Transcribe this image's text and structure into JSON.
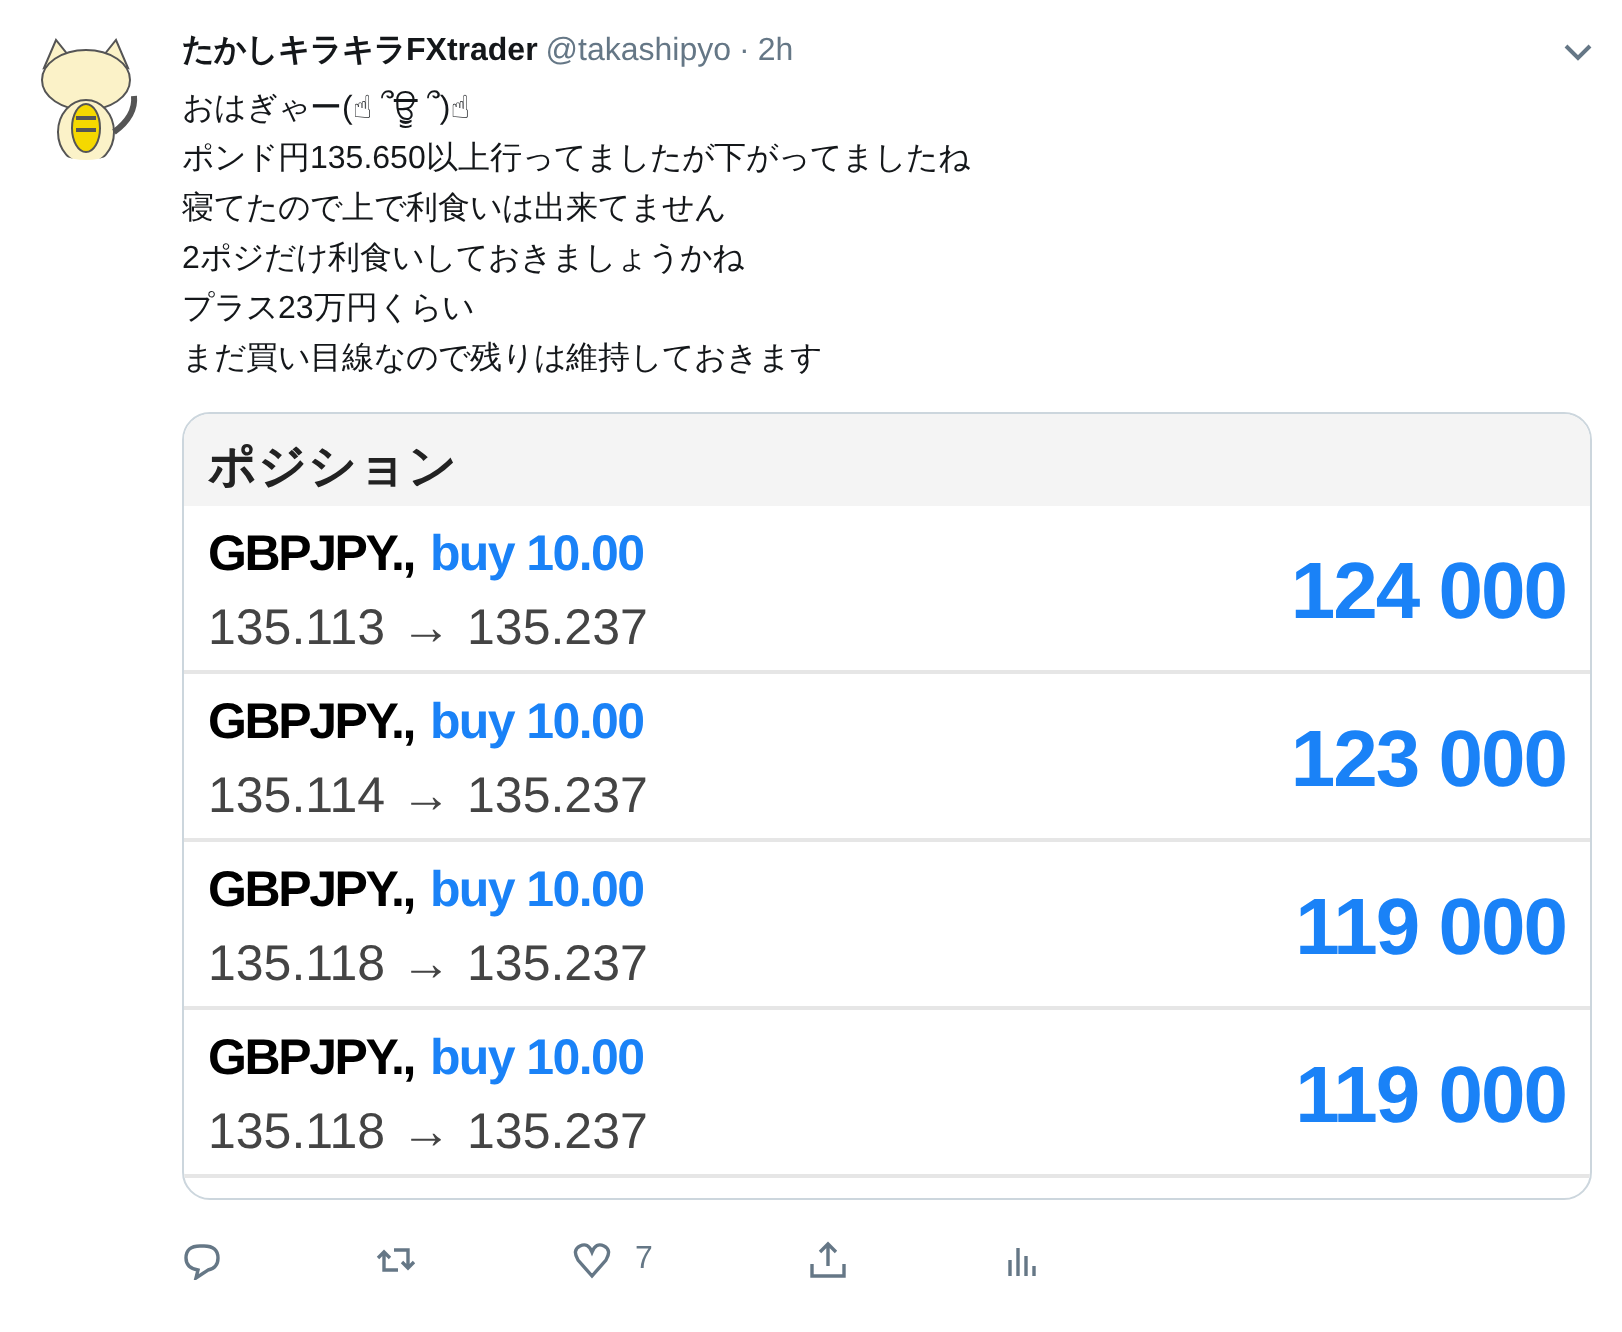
{
  "tweet": {
    "display_name": "たかしキラキラFXtrader",
    "handle": "@takashipyo",
    "separator": "·",
    "time": "2h",
    "lines": [
      "おはぎゃー(☝ ՞ਊ ՞)☝",
      "ポンド円135.650以上行ってましたが下がってましたね",
      "寝てたので上で利食いは出来てません",
      "2ポジだけ利食いしておきましょうかね",
      "プラス23万円くらい",
      "まだ買い目線なので残りは維持しておきます"
    ]
  },
  "attachment": {
    "title": "ポジション",
    "positions": [
      {
        "symbol": "GBPJPY.,",
        "side": "buy 10.00",
        "open": "135.113",
        "arrow": "→",
        "current": "135.237",
        "profit": "124 000"
      },
      {
        "symbol": "GBPJPY.,",
        "side": "buy 10.00",
        "open": "135.114",
        "arrow": "→",
        "current": "135.237",
        "profit": "123 000"
      },
      {
        "symbol": "GBPJPY.,",
        "side": "buy 10.00",
        "open": "135.118",
        "arrow": "→",
        "current": "135.237",
        "profit": "119 000"
      },
      {
        "symbol": "GBPJPY.,",
        "side": "buy 10.00",
        "open": "135.118",
        "arrow": "→",
        "current": "135.237",
        "profit": "119 000"
      }
    ]
  },
  "actions": [
    {
      "kind": "reply"
    },
    {
      "kind": "retweet"
    },
    {
      "kind": "like",
      "count": "7"
    },
    {
      "kind": "share"
    },
    {
      "kind": "analytics"
    }
  ]
}
